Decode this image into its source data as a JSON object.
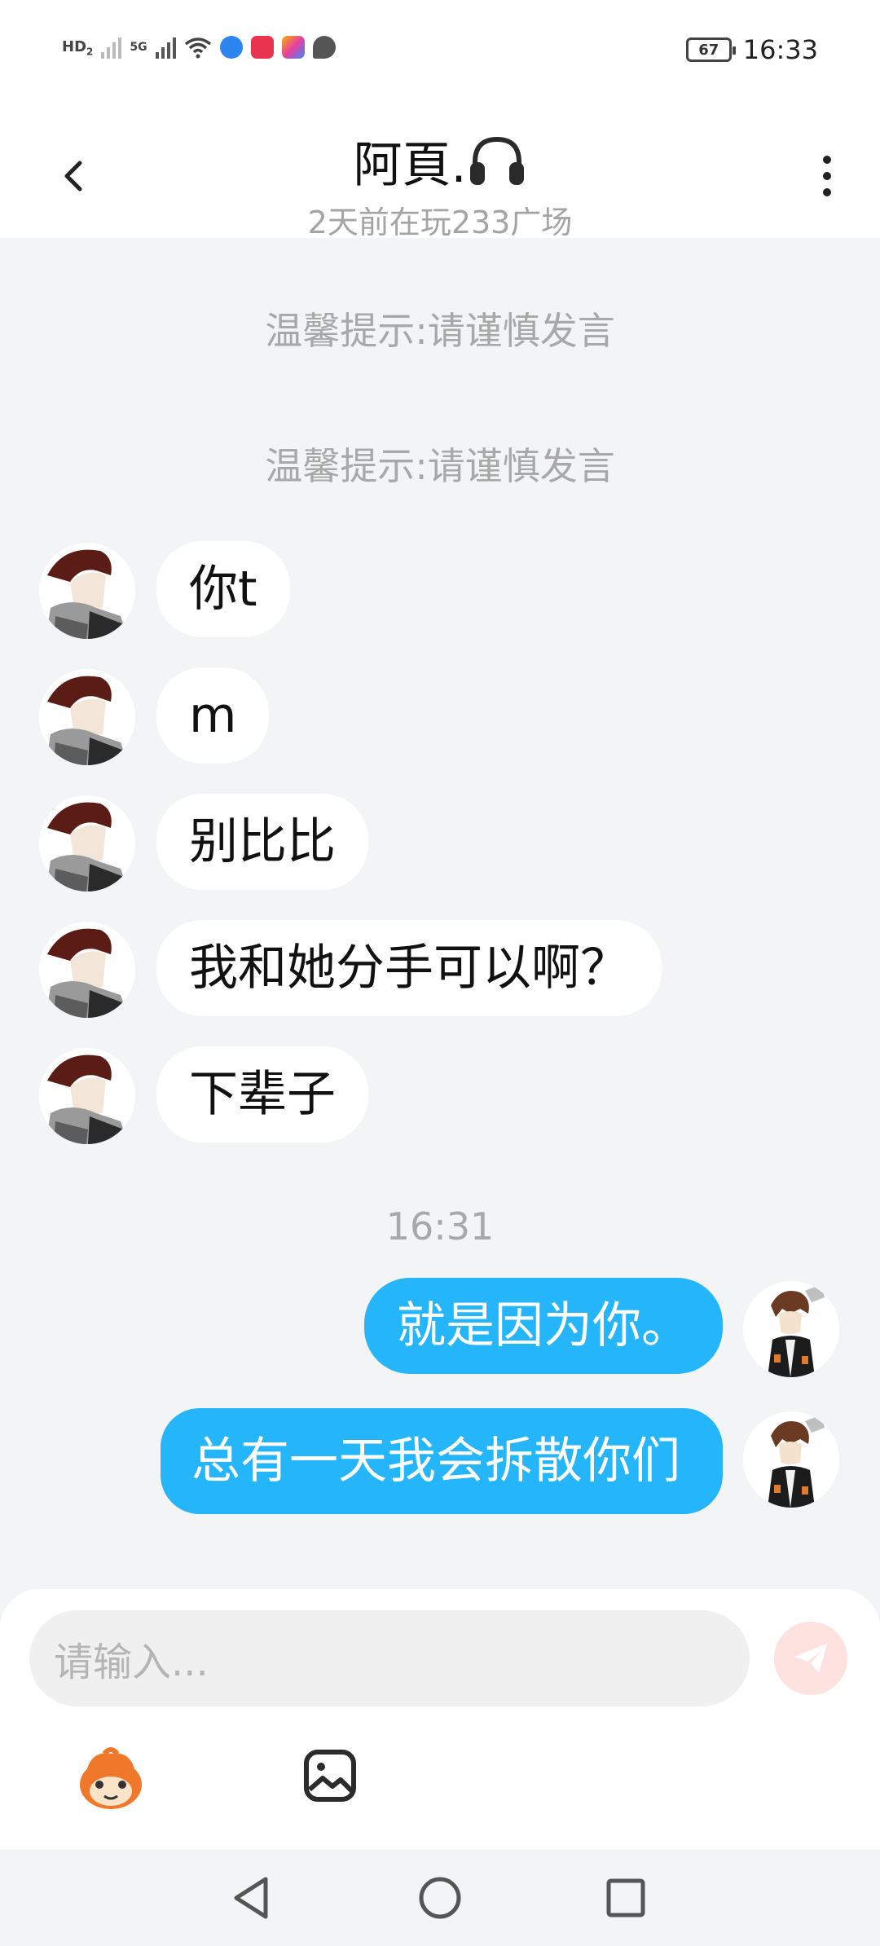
{
  "status_bar": {
    "hd_label": "HD",
    "hd_sub": "2",
    "network_label": "5G",
    "battery": "67",
    "time": "16:33"
  },
  "header": {
    "title": "阿頁.",
    "title_icon": "headphones-icon",
    "subtitle": "2天前在玩233广场"
  },
  "notices": [
    "温馨提示:请谨慎发言",
    "温馨提示:请谨慎发言"
  ],
  "incoming_messages": [
    {
      "text": "你t"
    },
    {
      "text": "m"
    },
    {
      "text": "别比比"
    },
    {
      "text": "我和她分手可以啊？"
    },
    {
      "text": "下辈子"
    }
  ],
  "time_divider": "16:31",
  "outgoing_messages": [
    {
      "text": "就是因为你。"
    },
    {
      "text": "总有一天我会拆散你们"
    }
  ],
  "input": {
    "placeholder": "请输入..."
  },
  "colors": {
    "outgoing_bubble": "#24b5fb",
    "send_button": "#fde2e0",
    "background": "#f3f4f6"
  }
}
